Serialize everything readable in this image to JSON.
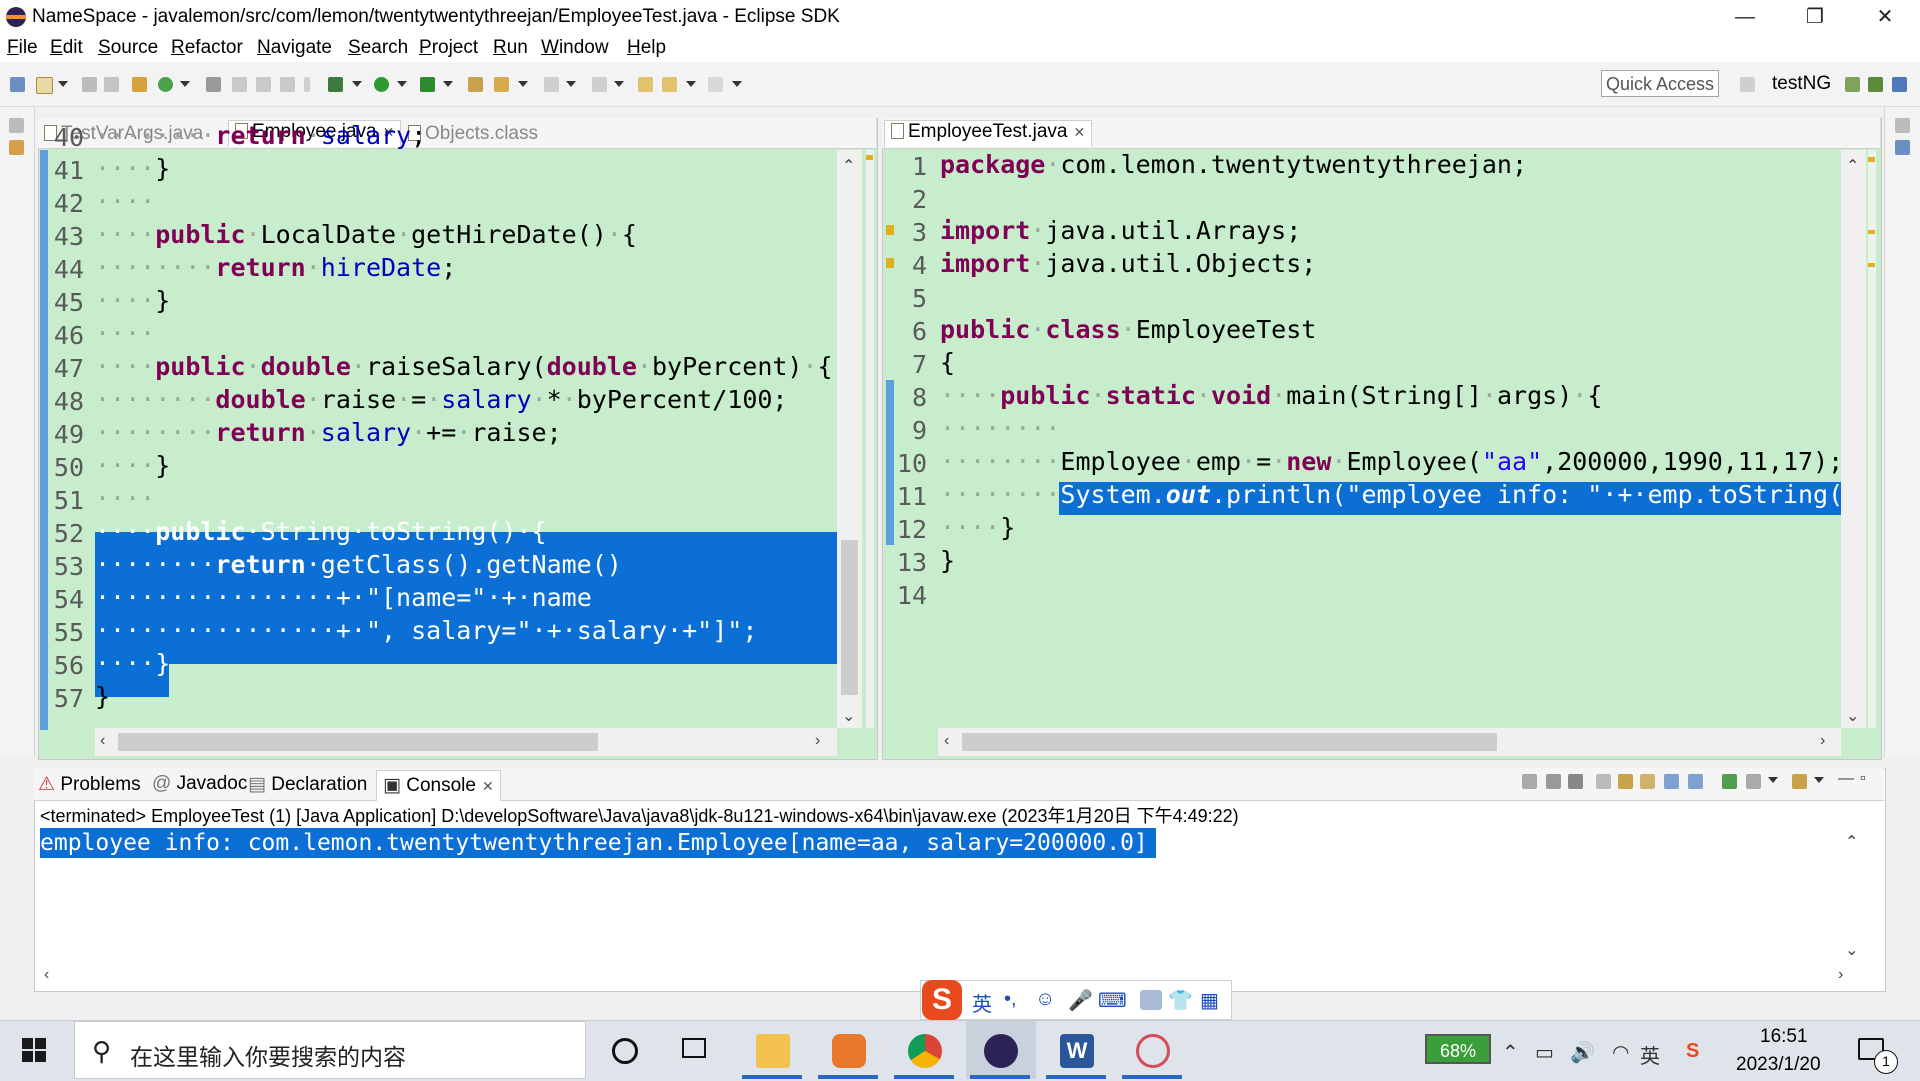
{
  "window": {
    "title": "NameSpace - javalemon/src/com/lemon/twentytwentythreejan/EmployeeTest.java - Eclipse SDK",
    "minimize": "—",
    "maximize": "❐",
    "close": "✕"
  },
  "menu": [
    "File",
    "Edit",
    "Source",
    "Refactor",
    "Navigate",
    "Search",
    "Project",
    "Run",
    "Window",
    "Help"
  ],
  "toolbar": {
    "quick_access": "Quick Access",
    "perspective": "testNG"
  },
  "left_editor": {
    "tabs": [
      {
        "label": "TestVarArgs.java",
        "active": false
      },
      {
        "label": "Employee.java",
        "active": true
      },
      {
        "label": "Objects.class",
        "active": false
      }
    ],
    "lines": [
      {
        "n": "40",
        "text": "return salary;"
      },
      {
        "n": "41",
        "text": "}"
      },
      {
        "n": "42",
        "text": ""
      },
      {
        "n": "43",
        "text": "public LocalDate getHireDate() {"
      },
      {
        "n": "44",
        "text": "return hireDate;"
      },
      {
        "n": "45",
        "text": "}"
      },
      {
        "n": "46",
        "text": ""
      },
      {
        "n": "47",
        "text": "public double raiseSalary(double byPercent) {"
      },
      {
        "n": "48",
        "text": "double raise = salary * byPercent/100;"
      },
      {
        "n": "49",
        "text": "return salary += raise;"
      },
      {
        "n": "50",
        "text": "}"
      },
      {
        "n": "51",
        "text": ""
      },
      {
        "n": "52",
        "text": "public String toString() {"
      },
      {
        "n": "53",
        "text": "return getClass().getName()"
      },
      {
        "n": "54",
        "text": "+ \"[name=\" + name"
      },
      {
        "n": "55",
        "text": "+ \", salary=\" + salary +\"]\";"
      },
      {
        "n": "56",
        "text": "}"
      },
      {
        "n": "57",
        "text": "}"
      }
    ]
  },
  "right_editor": {
    "tabs": [
      {
        "label": "EmployeeTest.java",
        "active": true
      }
    ],
    "lines": [
      {
        "n": "1",
        "text": "package com.lemon.twentytwentythreejan;"
      },
      {
        "n": "2",
        "text": ""
      },
      {
        "n": "3",
        "text": "import java.util.Arrays;"
      },
      {
        "n": "4",
        "text": "import java.util.Objects;"
      },
      {
        "n": "5",
        "text": ""
      },
      {
        "n": "6",
        "text": "public class EmployeeTest"
      },
      {
        "n": "7",
        "text": "{"
      },
      {
        "n": "8",
        "text": "public static void main(String[] args) {"
      },
      {
        "n": "9",
        "text": ""
      },
      {
        "n": "10",
        "text": "Employee emp = new Employee(\"aa\",200000,1990,11,17);"
      },
      {
        "n": "11",
        "text": "System.out.println(\"employee info: \" + emp.toString("
      },
      {
        "n": "12",
        "text": "}"
      },
      {
        "n": "13",
        "text": "}"
      },
      {
        "n": "14",
        "text": ""
      }
    ]
  },
  "console": {
    "tabs": [
      "Problems",
      "Javadoc",
      "Declaration",
      "Console"
    ],
    "active_tab": "Console",
    "status": "<terminated> EmployeeTest (1) [Java Application] D:\\developSoftware\\Java\\java8\\jdk-8u121-windows-x64\\bin\\javaw.exe (2023年1月20日 下午4:49:22)",
    "output": "employee info: com.lemon.twentytwentythreejan.Employee[name=aa, salary=200000.0]"
  },
  "ime": {
    "logo": "S",
    "lang": "英",
    "punct": "•,",
    "emoji": "☺",
    "mic": "🎤",
    "keyboard": "⌨",
    "shirt": "👕",
    "grid": "▦"
  },
  "taskbar": {
    "search_placeholder": "在这里输入你要搜索的内容",
    "battery": "68%",
    "ime_lang": "英",
    "time": "16:51",
    "date": "2023/1/20",
    "notification_count": "1"
  },
  "colors": {
    "editor_bg": "#c7edcc",
    "selection": "#0b6fd6",
    "keyword": "#7f0055",
    "field": "#0000c0",
    "string": "#2a00ff"
  }
}
